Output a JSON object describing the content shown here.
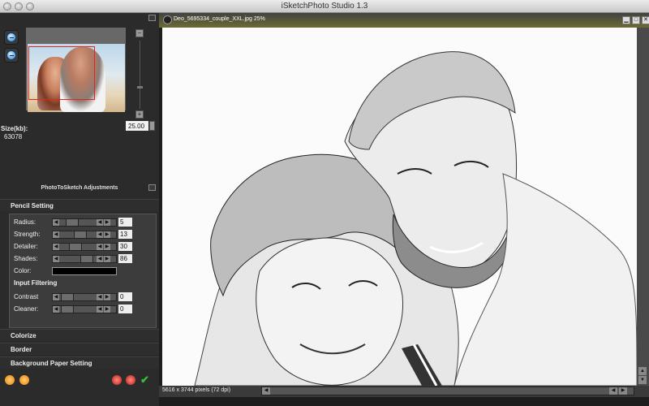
{
  "window": {
    "title": "iSketchPhoto Studio 1.3"
  },
  "navigator": {
    "size_label": "Size(kb):",
    "size_value": "63078",
    "zoom_value": "25.00",
    "zoom_in_icon": "zoom-in-icon",
    "zoom_out_icon": "zoom-out-icon"
  },
  "adjustments": {
    "section_title": "PhotoToSketch Adjustments",
    "pencil_header": "Pencil Setting",
    "rows": [
      {
        "label": "Radius:",
        "value": "5"
      },
      {
        "label": "Strength:",
        "value": "13"
      },
      {
        "label": "Detailer:",
        "value": "30"
      },
      {
        "label": "Shades:",
        "value": "86"
      }
    ],
    "color_label": "Color:",
    "color_value": "#000000",
    "input_filtering_header": "Input Filtering",
    "filter_rows": [
      {
        "label": "Contrast",
        "value": "0"
      },
      {
        "label": "Cleaner:",
        "value": "0"
      }
    ]
  },
  "sections": {
    "colorize": "Colorize",
    "border": "Border",
    "background": "Background Paper Setting"
  },
  "document": {
    "tab_name": "Deo_5695334_couple_XXL.jpg 25%",
    "status": "5616 x 3744 pixels (72 dpi)"
  },
  "icons": {
    "sun1": "sun-icon",
    "sun2": "sun-icon",
    "cancel1": "red-x-icon",
    "cancel2": "red-x-icon",
    "ok": "green-check-icon"
  }
}
